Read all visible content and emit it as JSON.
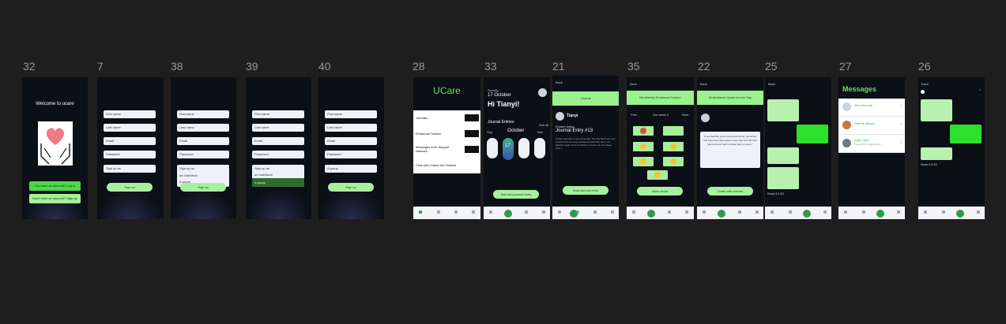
{
  "frames": [
    {
      "id": "32",
      "label": "32"
    },
    {
      "id": "7",
      "label": "7"
    },
    {
      "id": "38",
      "label": "38"
    },
    {
      "id": "39",
      "label": "39"
    },
    {
      "id": "40",
      "label": "40"
    },
    {
      "id": "28",
      "label": "28"
    },
    {
      "id": "33",
      "label": "33"
    },
    {
      "id": "21",
      "label": "21"
    },
    {
      "id": "35",
      "label": "35"
    },
    {
      "id": "22",
      "label": "22"
    },
    {
      "id": "25",
      "label": "25"
    },
    {
      "id": "27",
      "label": "27"
    },
    {
      "id": "26",
      "label": "26"
    }
  ],
  "welcome": {
    "title": "Welcome to ucare",
    "login_button": "You have an account? Log in",
    "signup_button": "Don't have an account? Sign up now"
  },
  "signup_form": {
    "first_name": "First name",
    "last_name": "Last name",
    "email": "Email",
    "password": "Password",
    "sign_up_as": "Sign up as",
    "option_individual": "an Individual",
    "option_group": "A group",
    "group_value": "A group",
    "submit": "Sign up"
  },
  "ucare_menu": {
    "logo": "UCare",
    "items": [
      "Journals",
      "Emotional Tracker",
      "Messages from Support Network",
      "Chat with Charis the Chatbot"
    ]
  },
  "journal_home": {
    "day": "Sunday",
    "date": "17 October",
    "greeting": "Hi Tianyi!",
    "section": "Journal Entries",
    "see_all": "See all",
    "month": "October",
    "prev": "Sep",
    "next": "Nov",
    "selected_day": "17",
    "add_button": "Add new journal entry"
  },
  "journal_entry": {
    "back": "Back",
    "banner": "Journal",
    "user": "Tianyi",
    "caption": "Posted today",
    "title": "Journal Entry #13",
    "body": "Today, has been a very tiring day. The day has been very packed with non-stop academics with little rest. I am drained, super tired and about to knock out and sleep now :)",
    "button": "Save journal entry"
  },
  "tracker": {
    "back": "Back",
    "banner": "My Weekly Emotional Tracker",
    "prev": "Prev",
    "week": "Oct week 2",
    "next": "Next",
    "button": "Save mood"
  },
  "quote": {
    "back": "Back",
    "banner": "Motivational Quote for the Day",
    "quote": "\"If you feel like you're losing everything, remember that trees lose their leaves every year and still they stand tall and wait for better days to come.\"",
    "button": "Share with friends"
  },
  "chat_thread": {
    "back": "Back",
    "timestamp": "Read 12:53"
  },
  "messages": {
    "title": "Messages",
    "contacts": [
      {
        "name": "Alex Marchal",
        "preview": ""
      },
      {
        "name": "Ramos Wilson",
        "preview": ""
      },
      {
        "name": "Kylie Lane",
        "preview": "Thank you for getting out..."
      }
    ]
  },
  "chatbot": {
    "back": "Back",
    "timestamp": "Read 12:53"
  },
  "colors": {
    "accent": "#4cd94c",
    "light_green": "#a8f0a0",
    "screen_bg": "#0b0f16",
    "canvas": "#1e1e1e"
  }
}
